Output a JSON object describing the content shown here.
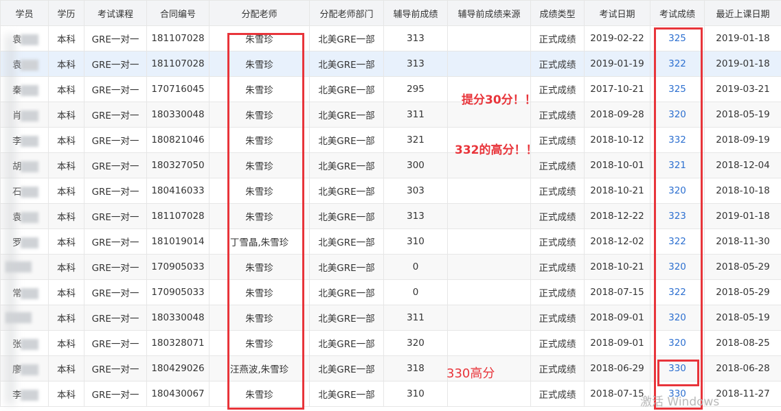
{
  "columns": [
    "学员",
    "学历",
    "考试课程",
    "合同编号",
    "分配老师",
    "分配老师部门",
    "辅导前成绩",
    "辅导前成绩来源",
    "成绩类型",
    "考试日期",
    "考试成绩",
    "最近上课日期"
  ],
  "rows": [
    {
      "name": "袁",
      "degree": "本科",
      "course": "GRE一对一",
      "contract": "181107028",
      "teacher": "朱雪珍",
      "dept": "北美GRE一部",
      "pre": "313",
      "src": "",
      "type": "正式成绩",
      "date": "2019-02-22",
      "score": "325",
      "last": "2019-01-18"
    },
    {
      "name": "袁",
      "degree": "本科",
      "course": "GRE一对一",
      "contract": "181107028",
      "teacher": "朱雪珍",
      "dept": "北美GRE一部",
      "pre": "313",
      "src": "",
      "type": "正式成绩",
      "date": "2019-01-19",
      "score": "322",
      "last": "2019-01-18"
    },
    {
      "name": "秦",
      "degree": "本科",
      "course": "GRE一对一",
      "contract": "170716045",
      "teacher": "朱雪珍",
      "dept": "北美GRE一部",
      "pre": "295",
      "src": "",
      "type": "正式成绩",
      "date": "2017-10-21",
      "score": "325",
      "last": "2019-03-21"
    },
    {
      "name": "肖",
      "degree": "本科",
      "course": "GRE一对一",
      "contract": "180330048",
      "teacher": "朱雪珍",
      "dept": "北美GRE一部",
      "pre": "311",
      "src": "",
      "type": "正式成绩",
      "date": "2018-09-28",
      "score": "320",
      "last": "2018-05-19"
    },
    {
      "name": "李",
      "degree": "本科",
      "course": "GRE一对一",
      "contract": "180821046",
      "teacher": "朱雪珍",
      "dept": "北美GRE一部",
      "pre": "321",
      "src": "",
      "type": "正式成绩",
      "date": "2018-10-12",
      "score": "332",
      "last": "2018-09-19"
    },
    {
      "name": "胡",
      "degree": "本科",
      "course": "GRE一对一",
      "contract": "180327050",
      "teacher": "朱雪珍",
      "dept": "北美GRE一部",
      "pre": "300",
      "src": "",
      "type": "正式成绩",
      "date": "2018-10-01",
      "score": "321",
      "last": "2018-12-04"
    },
    {
      "name": "石",
      "degree": "本科",
      "course": "GRE一对一",
      "contract": "180416033",
      "teacher": "朱雪珍",
      "dept": "北美GRE一部",
      "pre": "303",
      "src": "",
      "type": "正式成绩",
      "date": "2018-10-21",
      "score": "320",
      "last": "2018-10-18"
    },
    {
      "name": "袁",
      "degree": "本科",
      "course": "GRE一对一",
      "contract": "181107028",
      "teacher": "朱雪珍",
      "dept": "北美GRE一部",
      "pre": "313",
      "src": "",
      "type": "正式成绩",
      "date": "2018-12-22",
      "score": "323",
      "last": "2019-01-18"
    },
    {
      "name": "罗",
      "degree": "本科",
      "course": "GRE一对一",
      "contract": "181019014",
      "teacher": "丁雪晶,朱雪珍",
      "dept": "北美GRE一部",
      "pre": "310",
      "src": "",
      "type": "正式成绩",
      "date": "2018-12-02",
      "score": "322",
      "last": "2018-11-30"
    },
    {
      "name": "",
      "degree": "本科",
      "course": "GRE一对一",
      "contract": "170905033",
      "teacher": "朱雪珍",
      "dept": "北美GRE一部",
      "pre": "0",
      "src": "",
      "type": "正式成绩",
      "date": "2018-10-21",
      "score": "320",
      "last": "2018-05-29"
    },
    {
      "name": "常",
      "degree": "本科",
      "course": "GRE一对一",
      "contract": "170905033",
      "teacher": "朱雪珍",
      "dept": "北美GRE一部",
      "pre": "0",
      "src": "",
      "type": "正式成绩",
      "date": "2018-07-15",
      "score": "322",
      "last": "2018-05-29"
    },
    {
      "name": "",
      "degree": "本科",
      "course": "GRE一对一",
      "contract": "180330048",
      "teacher": "朱雪珍",
      "dept": "北美GRE一部",
      "pre": "311",
      "src": "",
      "type": "正式成绩",
      "date": "2018-09-01",
      "score": "320",
      "last": "2018-05-19"
    },
    {
      "name": "张",
      "degree": "本科",
      "course": "GRE一对一",
      "contract": "180328071",
      "teacher": "朱雪珍",
      "dept": "北美GRE一部",
      "pre": "320",
      "src": "",
      "type": "正式成绩",
      "date": "2018-09-01",
      "score": "320",
      "last": "2018-08-25"
    },
    {
      "name": "廖",
      "degree": "本科",
      "course": "GRE一对一",
      "contract": "180429026",
      "teacher": "汪燕波,朱雪珍",
      "dept": "北美GRE一部",
      "pre": "318",
      "src": "",
      "type": "正式成绩",
      "date": "2018-06-29",
      "score": "330",
      "last": "2018-06-28"
    },
    {
      "name": "李",
      "degree": "本科",
      "course": "GRE一对一",
      "contract": "180430067",
      "teacher": "朱雪珍",
      "dept": "北美GRE一部",
      "pre": "310",
      "src": "",
      "type": "正式成绩",
      "date": "2018-07-15",
      "score": "330",
      "last": "2018-11-27"
    }
  ],
  "annotations": {
    "note1": "提分30分！！",
    "note2": "332的高分！！",
    "note3": "330高分"
  },
  "watermark": "激活 Windows",
  "colors": {
    "header_bg": "#f3f4f6",
    "highlight_row": "#e8f1fc",
    "score_link": "#2c6fd0",
    "annotation_red": "#e8343a"
  }
}
